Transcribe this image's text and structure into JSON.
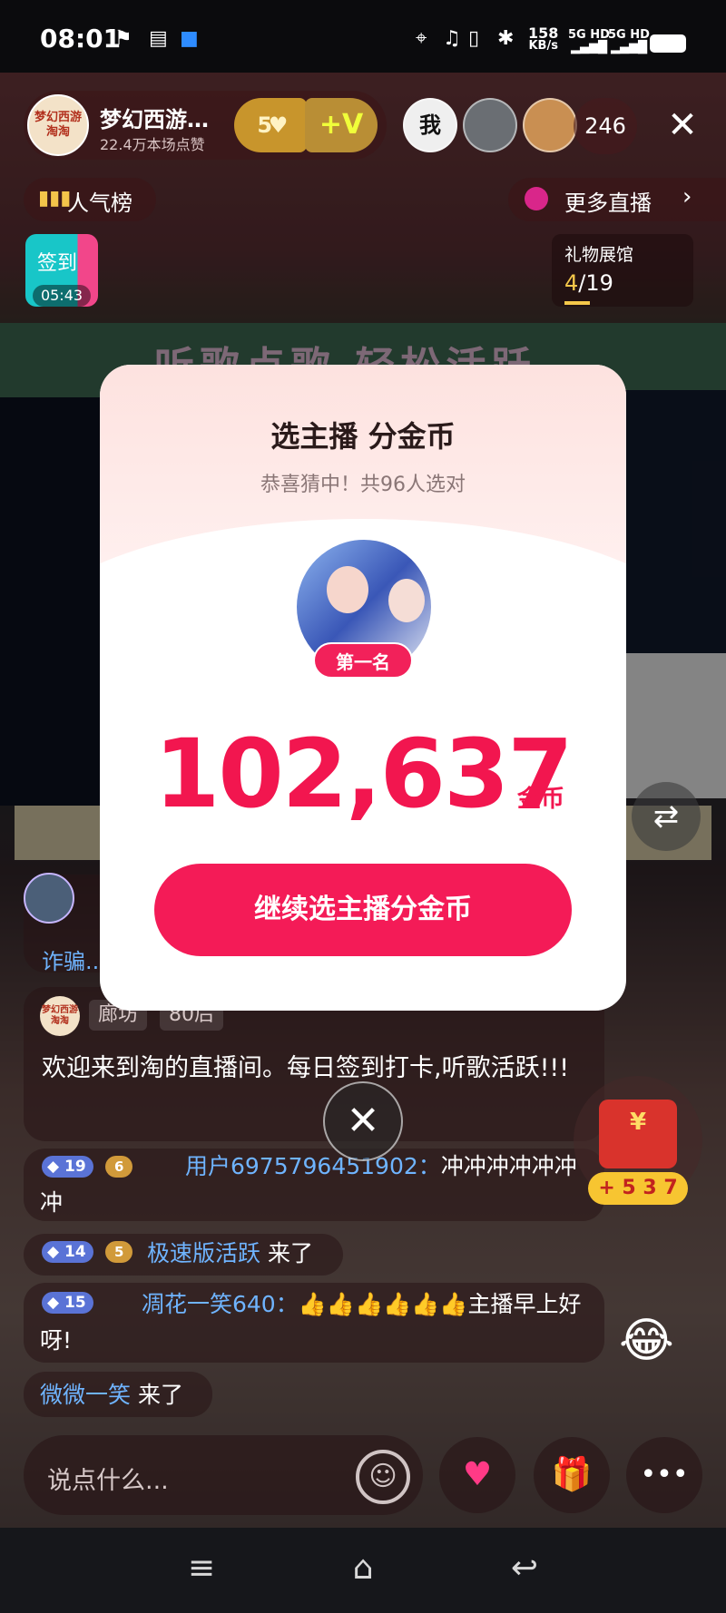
{
  "status_bar": {
    "time": "08:01",
    "net_speed_value": "158",
    "net_speed_unit": "KB/s",
    "sim1": "5G HD",
    "sim2": "5G HD"
  },
  "header": {
    "anchor_name": "梦幻西游…",
    "anchor_avatar_text": "梦幻西游 淘淘",
    "anchor_likes": "22.4万本场点赞",
    "fan_level": "5",
    "v_badge": "+V",
    "viewer1_text": "我",
    "viewer_count": "246",
    "close_icon": "✕",
    "rank_label": "人气榜",
    "more_live_label": "更多直播",
    "checkin_label": "签到",
    "checkin_timer": "05:43",
    "gift_gallery_title": "礼物展馆",
    "gift_gallery_current": "4",
    "gift_gallery_total": "/19"
  },
  "background": {
    "banner_text": "听歌点歌 轻松活跃"
  },
  "chat": {
    "partial_message": "诈骗...",
    "welcome_avatar_text": "梦幻西游 淘淘",
    "welcome_tag_city": "廊坊",
    "welcome_tag_age": "80后",
    "welcome_text": "欢迎来到淘的直播间。每日签到打卡,听歌活跃!!!",
    "messages": [
      {
        "level": "19",
        "fan": "6",
        "name": "用户6975796451902：",
        "text": "冲冲冲冲冲冲冲"
      },
      {
        "level": "14",
        "fan": "5",
        "name": "极速版活跃",
        "text": " 来了"
      },
      {
        "level": "15",
        "name": "凋花一笑640：",
        "text": "👍👍👍👍👍👍主播早上好呀!"
      },
      {
        "name": "微微一笑",
        "text": " 来了"
      }
    ]
  },
  "widgets": {
    "chest_badge": "+ 5 3 7"
  },
  "bottom_bar": {
    "input_placeholder": "说点什么..."
  },
  "modal": {
    "title": "选主播 分金币",
    "subtitle": "恭喜猜中！共96人选对",
    "rank_badge": "第一名",
    "coin_amount": "102,637",
    "coin_unit": "金币",
    "continue_button": "继续选主播分金币"
  },
  "colors": {
    "accent": "#f2164f",
    "button": "#f41b57",
    "username": "#6fb4ff"
  }
}
